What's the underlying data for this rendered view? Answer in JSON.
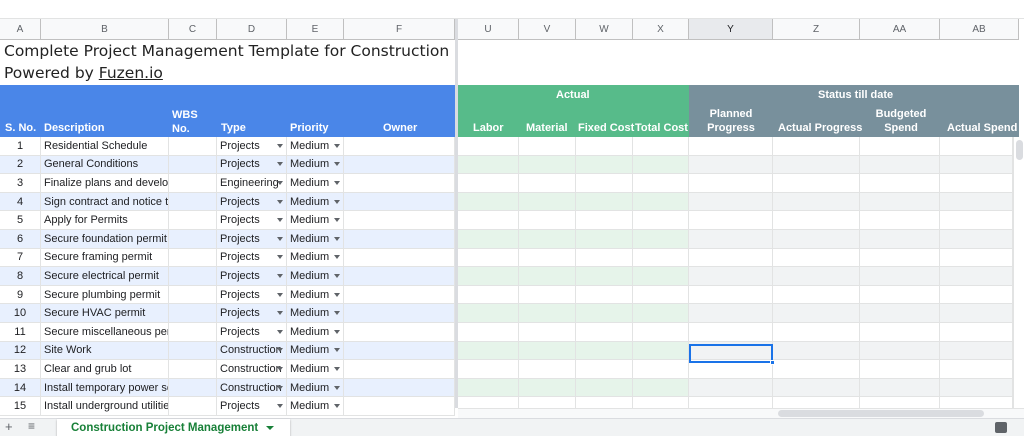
{
  "columns_left": [
    "A",
    "B",
    "C",
    "D",
    "E",
    "F"
  ],
  "columns_right": [
    "U",
    "V",
    "W",
    "X",
    "Y",
    "Z",
    "AA",
    "AB"
  ],
  "selected_column": "Y",
  "title_line1": "Complete Project Management Template for Construction",
  "title_line2_prefix": "Powered by ",
  "title_line2_link": "Fuzen.io",
  "headers": {
    "sno": "S. No.",
    "description": "Description",
    "wbs": "WBS No.",
    "type": "Type",
    "priority": "Priority",
    "owner": "Owner",
    "actual_group": "Actual",
    "status_group": "Status till date",
    "labor": "Labor",
    "material": "Material",
    "fixed_cost": "Fixed Cost",
    "total_cost": "Total Cost",
    "planned_progress": "Planned Progress",
    "actual_progress": "Actual Progress",
    "budgeted_spend": "Budgeted Spend",
    "actual_spend": "Actual Spend"
  },
  "rows": [
    {
      "n": "1",
      "desc": "Residential Schedule",
      "type": "Projects",
      "priority": "Medium"
    },
    {
      "n": "2",
      "desc": "General Conditions",
      "type": "Projects",
      "priority": "Medium"
    },
    {
      "n": "3",
      "desc": "Finalize plans and develop",
      "type": "Engineering",
      "priority": "Medium"
    },
    {
      "n": "4",
      "desc": "Sign contract and notice to",
      "type": "Projects",
      "priority": "Medium"
    },
    {
      "n": "5",
      "desc": "Apply for Permits",
      "type": "Projects",
      "priority": "Medium"
    },
    {
      "n": "6",
      "desc": "Secure foundation permit",
      "type": "Projects",
      "priority": "Medium"
    },
    {
      "n": "7",
      "desc": "Secure framing permit",
      "type": "Projects",
      "priority": "Medium"
    },
    {
      "n": "8",
      "desc": "Secure electrical permit",
      "type": "Projects",
      "priority": "Medium"
    },
    {
      "n": "9",
      "desc": "Secure plumbing permit",
      "type": "Projects",
      "priority": "Medium"
    },
    {
      "n": "10",
      "desc": "Secure HVAC permit",
      "type": "Projects",
      "priority": "Medium"
    },
    {
      "n": "11",
      "desc": "Secure miscellaneous permits",
      "type": "Projects",
      "priority": "Medium"
    },
    {
      "n": "12",
      "desc": "Site Work",
      "type": "Construction",
      "priority": "Medium"
    },
    {
      "n": "13",
      "desc": "Clear and grub lot",
      "type": "Construction",
      "priority": "Medium"
    },
    {
      "n": "14",
      "desc": "Install temporary power service",
      "type": "Construction",
      "priority": "Medium"
    },
    {
      "n": "15",
      "desc": "Install underground utilities",
      "type": "Projects",
      "priority": "Medium"
    }
  ],
  "sheet_tab": "Construction Project Management",
  "colors": {
    "blue_header": "#4a86e8",
    "green_header": "#57bb8a",
    "gray_header": "#78909c",
    "row_band": "#e8f0fe",
    "green_band": "#e6f4ea",
    "gray_band": "#f1f3f4",
    "tab_text": "#188038"
  }
}
